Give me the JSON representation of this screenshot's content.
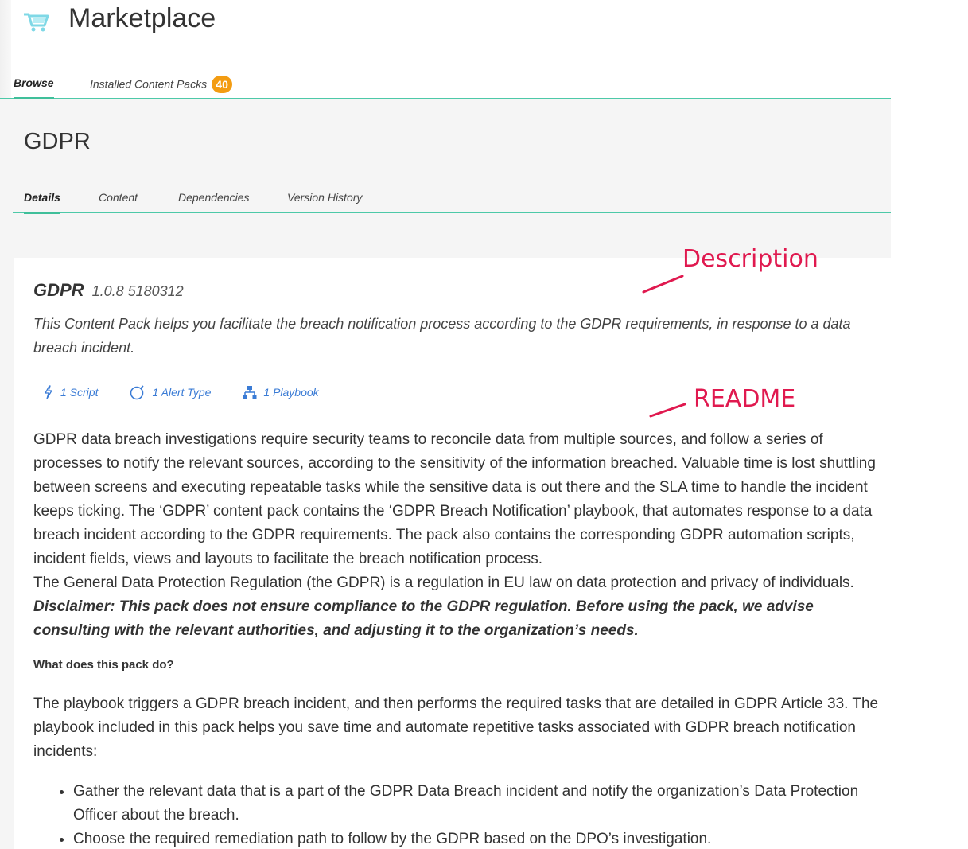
{
  "header": {
    "title": "Marketplace",
    "icon": "cart-icon"
  },
  "top_tabs": {
    "browse": "Browse",
    "installed": "Installed Content Packs",
    "installed_count": "40"
  },
  "pack": {
    "name": "GDPR",
    "version": "1.0.8 5180312",
    "description": "This Content Pack helps you facilitate the breach notification process according to the GDPR requirements, in response to a data breach incident."
  },
  "sub_tabs": {
    "details": "Details",
    "content": "Content",
    "dependencies": "Dependencies",
    "version_history": "Version History"
  },
  "content_items": {
    "script": "1 Script",
    "alert_type": "1 Alert Type",
    "playbook": "1 Playbook"
  },
  "readme": {
    "p1": "GDPR data breach investigations require security teams to reconcile data from multiple sources, and follow a series of processes to notify the relevant sources, according to the sensitivity of the information breached. Valuable time is lost shuttling between screens and executing repeatable tasks while the sensitive data is out there and the SLA time to handle the incident keeps ticking. The ‘GDPR’ content pack contains the ‘GDPR Breach Notification’ playbook, that automates response to a data breach incident according to the GDPR requirements. The pack also contains the corresponding GDPR automation scripts, incident fields, views and layouts to facilitate the breach notification process.",
    "p_regulation": "The General Data Protection Regulation (the GDPR) is a regulation in EU law on data protection and privacy of individuals.",
    "disclaimer": "Disclaimer: This pack does not ensure compliance to the GDPR regulation. Before using the pack, we advise consulting with the relevant authorities, and adjusting it to the organization’s needs.",
    "heading": "What does this pack do?",
    "p2": "The playbook triggers a GDPR breach incident, and then performs the required tasks that are detailed in GDPR Article 33. The playbook included in this pack helps you save time and automate repetitive tasks associated with GDPR breach notification incidents:",
    "bullets": [
      "Gather the relevant data that is a part of the GDPR Data Breach incident and notify the organization’s Data Protection Officer about the breach.",
      "Choose the required remediation path to follow by the GDPR based on the DPO’s investigation."
    ]
  },
  "annotations": {
    "description": "Description",
    "readme": "README",
    "color": "#e0194f"
  },
  "colors": {
    "accent": "#3fbf9a",
    "link": "#3a7bd5",
    "badge": "#f39c12"
  }
}
